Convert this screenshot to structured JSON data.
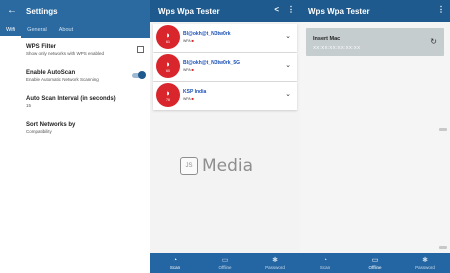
{
  "settings": {
    "title": "Settings",
    "tabs": [
      "Wifi",
      "General",
      "About"
    ],
    "items": [
      {
        "title": "WPS Filter",
        "subtitle": "Show only networks with WPS enabled"
      },
      {
        "title": "Enable AutoScan",
        "subtitle": "Enable Automatic Network Scanning"
      },
      {
        "title": "Auto Scan Interval (in seconds)",
        "subtitle": "15"
      },
      {
        "title": "Sort Networks by",
        "subtitle": "Compatibility"
      }
    ],
    "wps_filter_checked": false,
    "autoscan_enabled": true
  },
  "tester": {
    "title": "Wps Wpa Tester",
    "networks": [
      {
        "ssid": "Bl@okh@t_N3tw0rk",
        "security": "WPA",
        "signal": "61"
      },
      {
        "ssid": "Bl@okh@t_N3tw0rk_5G",
        "security": "WPA",
        "signal": "60"
      },
      {
        "ssid": "KSP India",
        "security": "WPA",
        "signal": "76"
      }
    ],
    "nav": [
      "Scan",
      "Offline",
      "Password"
    ],
    "active_nav": "Scan"
  },
  "mac_screen": {
    "title": "Wps Wpa Tester",
    "insert_label": "Insert Mac",
    "mac_value": "XX:XX:XX:XX:XX:XX",
    "nav": [
      "Scan",
      "Offline",
      "Password"
    ],
    "active_nav": "Offline"
  },
  "watermark": {
    "logo": "JS",
    "text": "Media"
  },
  "colors": {
    "appbar": "#1f5a8e",
    "accent": "#d8262c",
    "nav": "#2466a3"
  }
}
